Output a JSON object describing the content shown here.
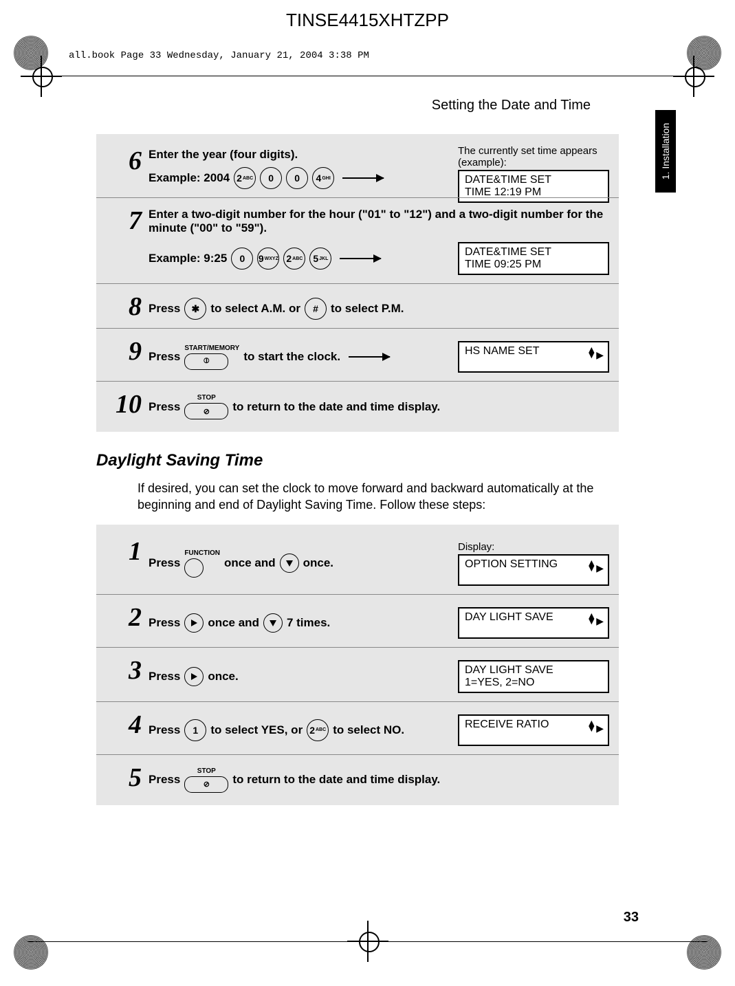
{
  "doc_code": "TINSE4415XHTZPP",
  "book_note": "all.book  Page 33  Wednesday, January 21, 2004  3:38 PM",
  "header": "Setting the Date and Time",
  "side_tab": "1. Installation",
  "page_number": "33",
  "steps_a": [
    {
      "num": "6",
      "text": "Enter the year (four digits).",
      "example_label": "Example: 2004",
      "keys": [
        "2",
        "0",
        "0",
        "4"
      ],
      "key_supers": [
        "ABC",
        "",
        "",
        "GHI"
      ],
      "note": "The currently set time appears (example):",
      "display": "DATE&TIME SET\nTIME  12:19   PM"
    },
    {
      "num": "7",
      "text": "Enter a two-digit number for the hour (\"01\" to \"12\") and a two-digit number for the minute (\"00\" to \"59\").",
      "example_label": "Example: 9:25",
      "keys": [
        "0",
        "9",
        "2",
        "5"
      ],
      "key_supers": [
        "",
        "WXYZ",
        "ABC",
        "JKL"
      ],
      "display": "DATE&TIME SET\nTIME  09:25   PM"
    },
    {
      "num": "8",
      "text_parts": [
        "Press ",
        " to select A.M. or ",
        " to select P.M."
      ],
      "key_a": "✱",
      "key_b": "#"
    },
    {
      "num": "9",
      "text_parts": [
        "Press ",
        " to start the clock."
      ],
      "oval_label": "START/MEMORY",
      "oval_icon": "⦶",
      "display": "HS NAME SET",
      "nav_arrows": true
    },
    {
      "num": "10",
      "text_parts": [
        "Press ",
        " to return to the date and time display."
      ],
      "oval_label": "STOP",
      "oval_icon": "⊘"
    }
  ],
  "section_b_title": "Daylight Saving Time",
  "section_b_para": "If desired, you can set the clock to move forward and backward automatically at the beginning and end of Daylight Saving Time. Follow these steps:",
  "steps_b": [
    {
      "num": "1",
      "text_parts": [
        "Press ",
        " once and ",
        " once."
      ],
      "oval_label": "FUNCTION",
      "oval_shape_empty": true,
      "nav_icon": "down",
      "display_note": "Display:",
      "display": "OPTION SETTING",
      "nav_arrows": true
    },
    {
      "num": "2",
      "text_parts": [
        "Press ",
        " once and ",
        " 7 times."
      ],
      "nav_icon_a": "right",
      "nav_icon_b": "down",
      "display": "DAY LIGHT SAVE",
      "nav_arrows": true
    },
    {
      "num": "3",
      "text_parts": [
        "Press ",
        " once."
      ],
      "nav_icon_a": "right",
      "display": "DAY LIGHT SAVE\n1=YES, 2=NO"
    },
    {
      "num": "4",
      "text_parts": [
        "Press ",
        " to select YES, or ",
        " to select NO."
      ],
      "key_a": "1",
      "key_b": "2",
      "key_b_super": "ABC",
      "display": "RECEIVE RATIO",
      "nav_arrows": true
    },
    {
      "num": "5",
      "text_parts": [
        "Press ",
        " to return to the date and time display."
      ],
      "oval_label": "STOP",
      "oval_icon": "⊘"
    }
  ]
}
